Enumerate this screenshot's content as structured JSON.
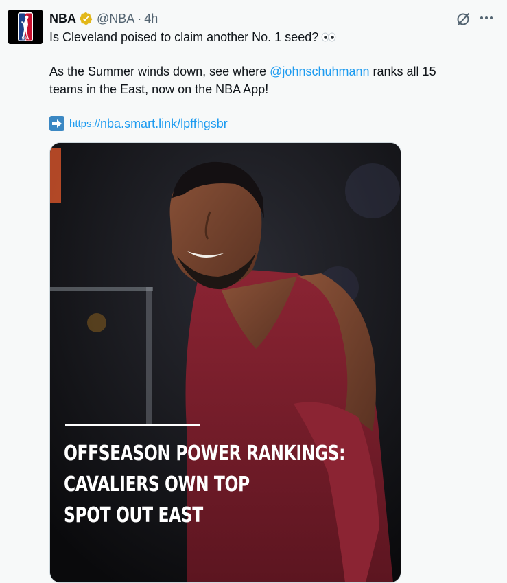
{
  "tweet": {
    "author_name": "NBA",
    "handle": "@NBA",
    "separator": "·",
    "time": "4h",
    "line1": "Is Cleveland poised to claim another No. 1 seed?",
    "line2_pre": "As the Summer winds down, see where ",
    "mention": "@johnschuhmann",
    "line2_post": " ranks all 15",
    "line3": "teams in the East, now on the NBA App!",
    "link_prefix": "https://",
    "link_text": "nba.smart.link/lpffhgsbr"
  },
  "media": {
    "headline_lines": [
      "OFFSEASON POWER RANKINGS:",
      "CAVALIERS OWN TOP",
      "SPOT OUT EAST"
    ]
  },
  "colors": {
    "link": "#1d9bf0",
    "text": "#0f1419",
    "secondary": "#536471",
    "background": "#f7f9f9",
    "verified": "#e2b719",
    "jersey": "#7a1f2b"
  },
  "icons": {
    "verified": "verified-badge-icon",
    "grok": "grok-icon",
    "more": "more-icon",
    "arrow": "right-arrow-emoji-icon",
    "eyes": "eyes-emoji-icon"
  }
}
